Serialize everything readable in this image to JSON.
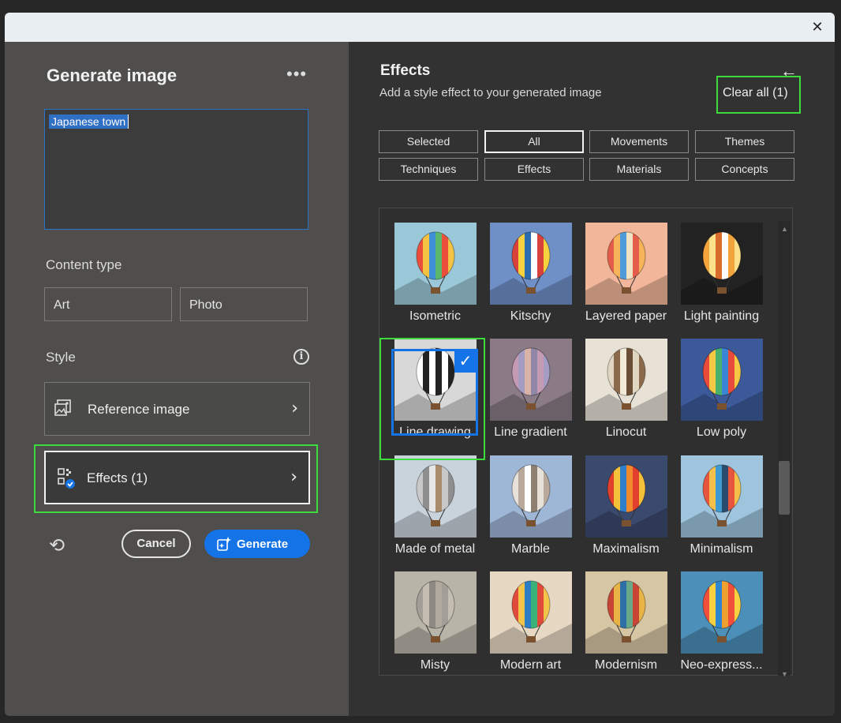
{
  "left": {
    "title": "Generate image",
    "more_label": "•••",
    "prompt_text": "Japanese town",
    "content_type_label": "Content type",
    "content_types": [
      "Art",
      "Photo"
    ],
    "style_label": "Style",
    "info_glyph": "i",
    "reference_image_label": "Reference image",
    "effects_label": "Effects (1)",
    "chevron": "›",
    "reset_glyph": "⟲",
    "cancel_label": "Cancel",
    "generate_label": "Generate"
  },
  "right": {
    "title": "Effects",
    "subtitle": "Add a style effect to your generated image",
    "back_glyph": "←",
    "clear_all_label": "Clear all (1)",
    "filters": [
      "Selected",
      "All",
      "Movements",
      "Themes",
      "Techniques",
      "Effects",
      "Materials",
      "Concepts"
    ],
    "active_filter": "All",
    "check_glyph": "✓",
    "tiles": [
      {
        "label": "Isometric",
        "bg": "#9bc8d8"
      },
      {
        "label": "Kitschy",
        "bg": "#6f8fc7"
      },
      {
        "label": "Layered paper",
        "bg": "#f2b79a"
      },
      {
        "label": "Light painting",
        "bg": "#222222"
      },
      {
        "label": "Line drawing",
        "bg": "#d8d8d8"
      },
      {
        "label": "Line gradient",
        "bg": "#8a7b86"
      },
      {
        "label": "Linocut",
        "bg": "#e8e2d6"
      },
      {
        "label": "Low poly",
        "bg": "#3c5a9a"
      },
      {
        "label": "Made of metal",
        "bg": "#c9d3dc"
      },
      {
        "label": "Marble",
        "bg": "#9fb7d6"
      },
      {
        "label": "Maximalism",
        "bg": "#3a4a6e"
      },
      {
        "label": "Minimalism",
        "bg": "#9ec4de"
      },
      {
        "label": "Misty",
        "bg": "#b9b4a8"
      },
      {
        "label": "Modern art",
        "bg": "#e7d8c4"
      },
      {
        "label": "Modernism",
        "bg": "#d6c6a4"
      },
      {
        "label": "Neo-express...",
        "bg": "#4c8fb8"
      }
    ]
  },
  "colors": {
    "accent": "#1473e6",
    "highlight": "#3ddc3d"
  }
}
